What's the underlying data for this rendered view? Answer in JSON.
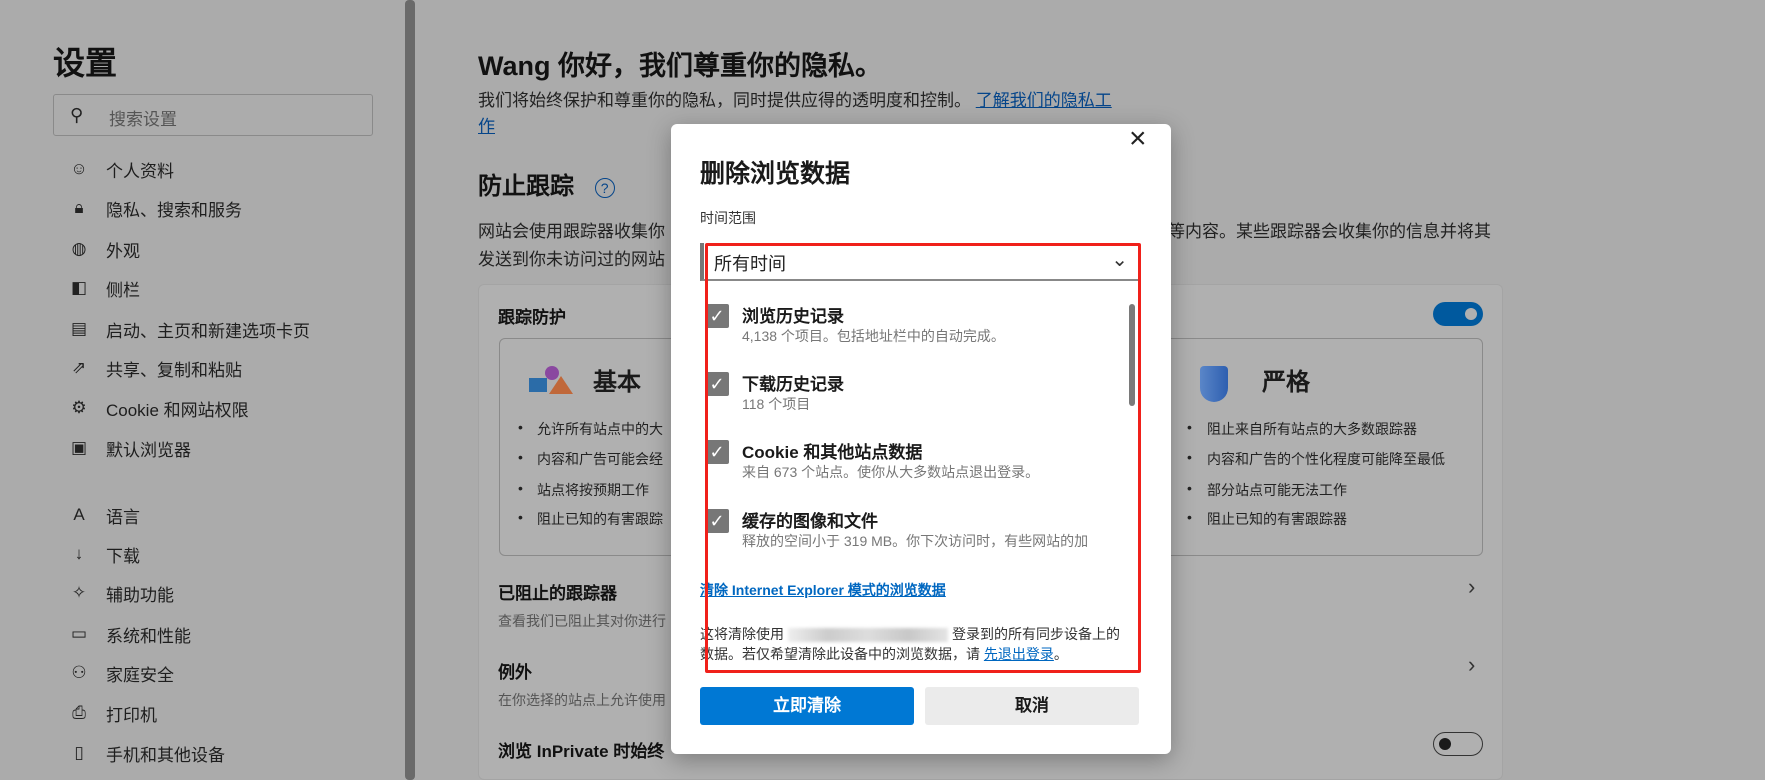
{
  "sidebar": {
    "title": "设置",
    "search_placeholder": "搜索设置",
    "items": [
      {
        "label": "个人资料",
        "icon": "profile-icon",
        "glyph": "☺"
      },
      {
        "label": "隐私、搜索和服务",
        "icon": "lock-icon",
        "glyph": "🔒︎"
      },
      {
        "label": "外观",
        "icon": "palette-icon",
        "glyph": "◍"
      },
      {
        "label": "侧栏",
        "icon": "sidebar-icon",
        "glyph": "◧"
      },
      {
        "label": "启动、主页和新建选项卡页",
        "icon": "start-page-icon",
        "glyph": "▤"
      },
      {
        "label": "共享、复制和粘贴",
        "icon": "share-icon",
        "glyph": "⇗"
      },
      {
        "label": "Cookie 和网站权限",
        "icon": "cookie-permissions-icon",
        "glyph": "⚙"
      },
      {
        "label": "默认浏览器",
        "icon": "default-browser-icon",
        "glyph": "▣"
      },
      {
        "label": "语言",
        "icon": "language-icon",
        "glyph": "A"
      },
      {
        "label": "下载",
        "icon": "download-icon",
        "glyph": "↓"
      },
      {
        "label": "辅助功能",
        "icon": "accessibility-icon",
        "glyph": "✧"
      },
      {
        "label": "系统和性能",
        "icon": "laptop-icon",
        "glyph": "▭"
      },
      {
        "label": "家庭安全",
        "icon": "family-icon",
        "glyph": "⚇"
      },
      {
        "label": "打印机",
        "icon": "printer-icon",
        "glyph": "⎙"
      },
      {
        "label": "手机和其他设备",
        "icon": "phone-icon",
        "glyph": "▯"
      }
    ]
  },
  "main": {
    "greeting": "Wang 你好，我们尊重你的隐私。",
    "intro": "我们将始终保护和尊重你的隐私，同时提供应得的透明度和控制。",
    "intro_link_1": "了解我们的隐私工",
    "intro_link_2": "作",
    "tracking_title": "防止跟踪",
    "tracking_desc_1a": "网站会使用跟踪器收集你",
    "tracking_desc_1b": "等内容。某些跟踪器会收集你的信息并将其",
    "tracking_desc_2": "发送到你未访问过的网站",
    "card": {
      "title": "跟踪防护",
      "toggle_on": true,
      "basic": {
        "title": "基本",
        "bullets": [
          "允许所有站点中的大",
          "内容和广告可能会经",
          "站点将按预期工作",
          "阻止已知的有害跟踪"
        ]
      },
      "strict": {
        "title": "严格",
        "bullets": [
          "阻止来自所有站点的大多数跟踪器",
          "内容和广告的个性化程度可能降至最低",
          "部分站点可能无法工作",
          "阻止已知的有害跟踪器"
        ]
      },
      "blocked_title": "已阻止的跟踪器",
      "blocked_sub": "查看我们已阻止其对你进行",
      "exceptions_title": "例外",
      "exceptions_sub": "在你选择的站点上允许使用",
      "inprivate_title": "浏览 InPrivate 时始终",
      "inprivate_toggle_on": false
    }
  },
  "dialog": {
    "title": "删除浏览数据",
    "time_range_label": "时间范围",
    "time_range_value": "所有时间",
    "items": [
      {
        "label": "浏览历史记录",
        "desc": "4,138 个项目。包括地址栏中的自动完成。",
        "checked": true
      },
      {
        "label": "下载历史记录",
        "desc": "118 个项目",
        "checked": true
      },
      {
        "label": "Cookie 和其他站点数据",
        "desc": "来自 673 个站点。使你从大多数站点退出登录。",
        "checked": true
      },
      {
        "label": "缓存的图像和文件",
        "desc": "释放的空间小于 319 MB。你下次访问时，有些网站的加",
        "checked": true
      }
    ],
    "ie_link": "清除 Internet Explorer 模式的浏览数据",
    "note_1a": "这将清除使用",
    "note_1b": "登录到的所有同步设备上的",
    "note_2": "数据。若仅希望清除此设备中的浏览数据，请",
    "note_link": "先退出登录",
    "note_end": "。",
    "clear_button": "立即清除",
    "cancel_button": "取消",
    "accent": "#0078d4",
    "highlight": "#f0201a"
  }
}
